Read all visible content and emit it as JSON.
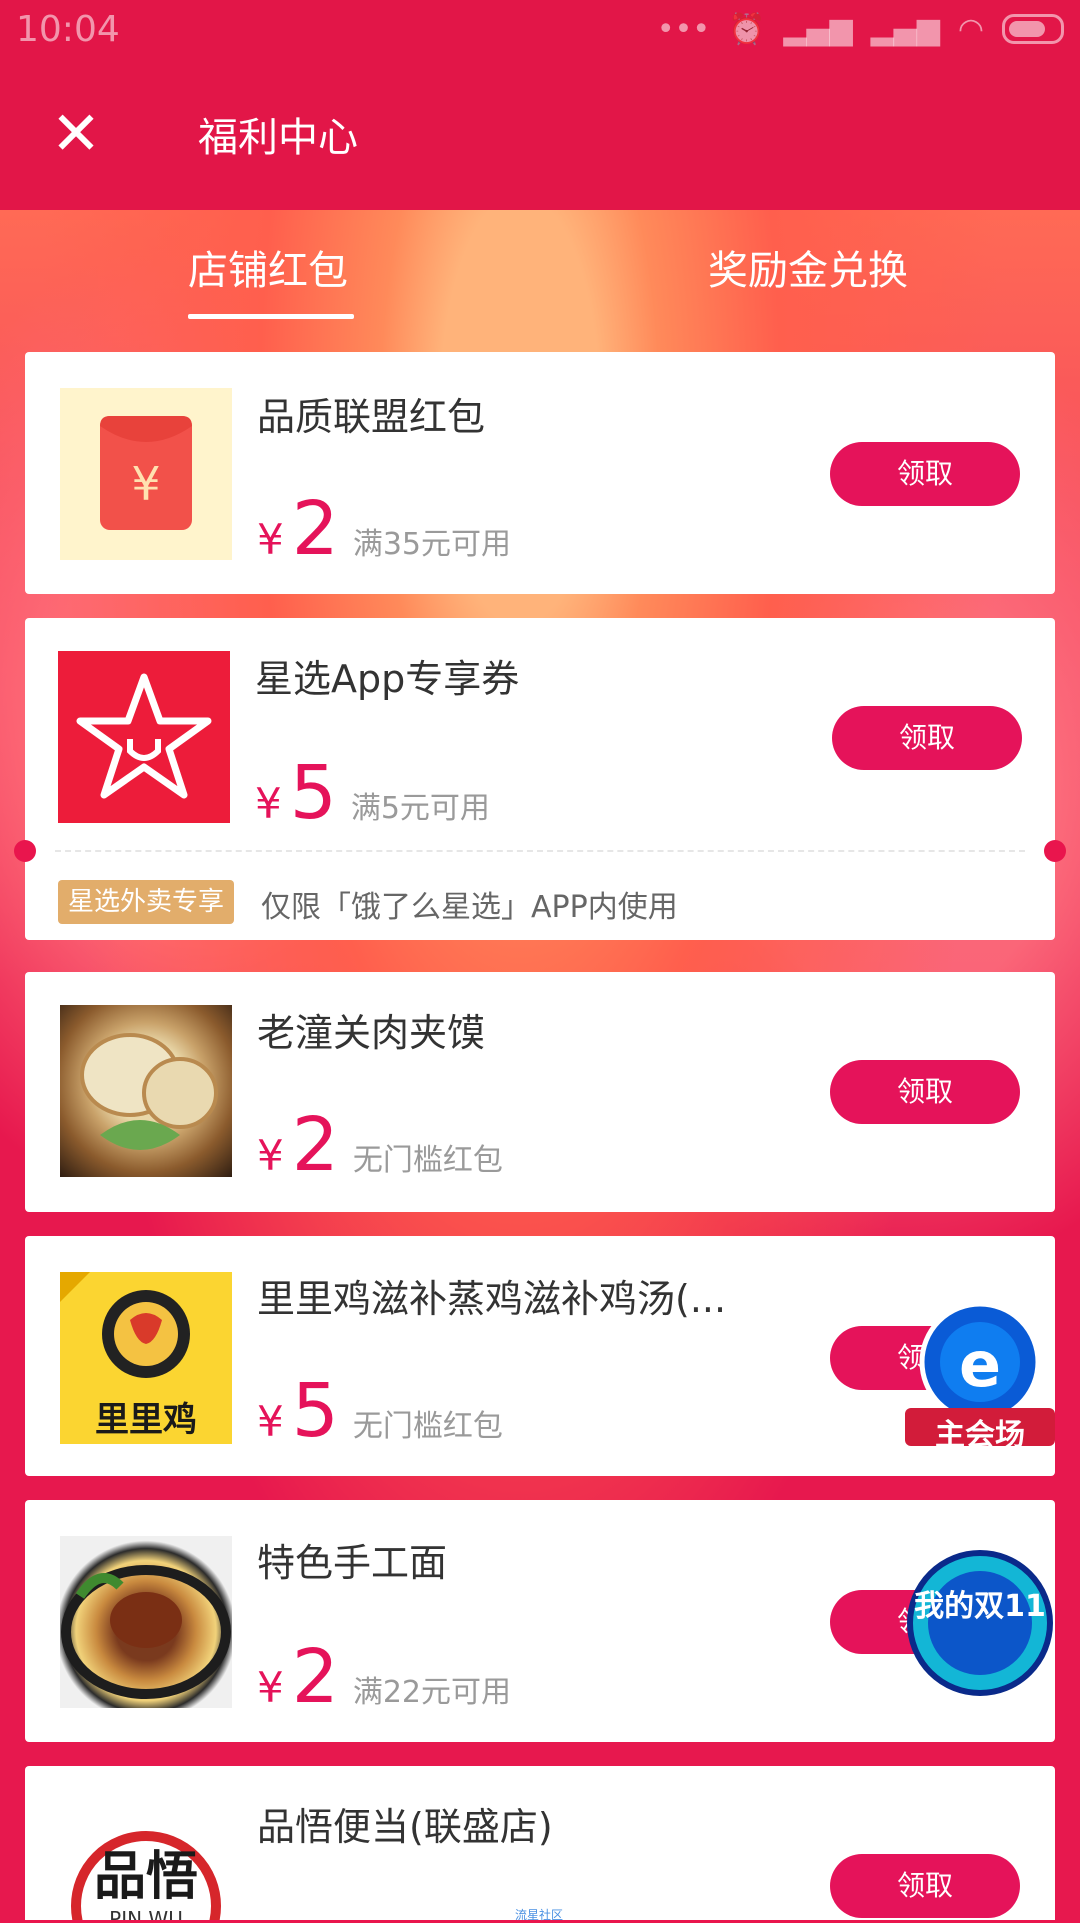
{
  "status": {
    "time": "10:04"
  },
  "header": {
    "title": "福利中心"
  },
  "tabs": [
    {
      "label": "店铺红包"
    },
    {
      "label": "奖励金兑换"
    }
  ],
  "cards": [
    {
      "title": "品质联盟红包",
      "yen": "¥",
      "amount": "2",
      "condition": "满35元可用",
      "button": "领取"
    },
    {
      "title": "星选App专享券",
      "yen": "¥",
      "amount": "5",
      "condition": "满5元可用",
      "button": "领取",
      "tag": "星选外卖专享",
      "tag_desc": "仅限「饿了么星选」APP内使用"
    },
    {
      "title": "老潼关肉夹馍",
      "yen": "¥",
      "amount": "2",
      "condition": "无门槛红包",
      "button": "领取"
    },
    {
      "title": "里里鸡滋补蒸鸡滋补鸡汤(...",
      "yen": "¥",
      "amount": "5",
      "condition": "无门槛红包",
      "button": "领取"
    },
    {
      "title": "特色手工面",
      "yen": "¥",
      "amount": "2",
      "condition": "满22元可用",
      "button": "领取"
    },
    {
      "title": "品悟便当(联盛店)",
      "button": "领取"
    }
  ],
  "floats": {
    "main_venue": "主会场",
    "my_double11": "我的双11"
  },
  "thumb_text": {
    "lili_logo": "里里鸡",
    "pinwu_logo": "品悟"
  },
  "watermark": "流星社区",
  "colors": {
    "accent": "#e5135a",
    "header": "#e21648",
    "tag": "#e2ad6b"
  }
}
